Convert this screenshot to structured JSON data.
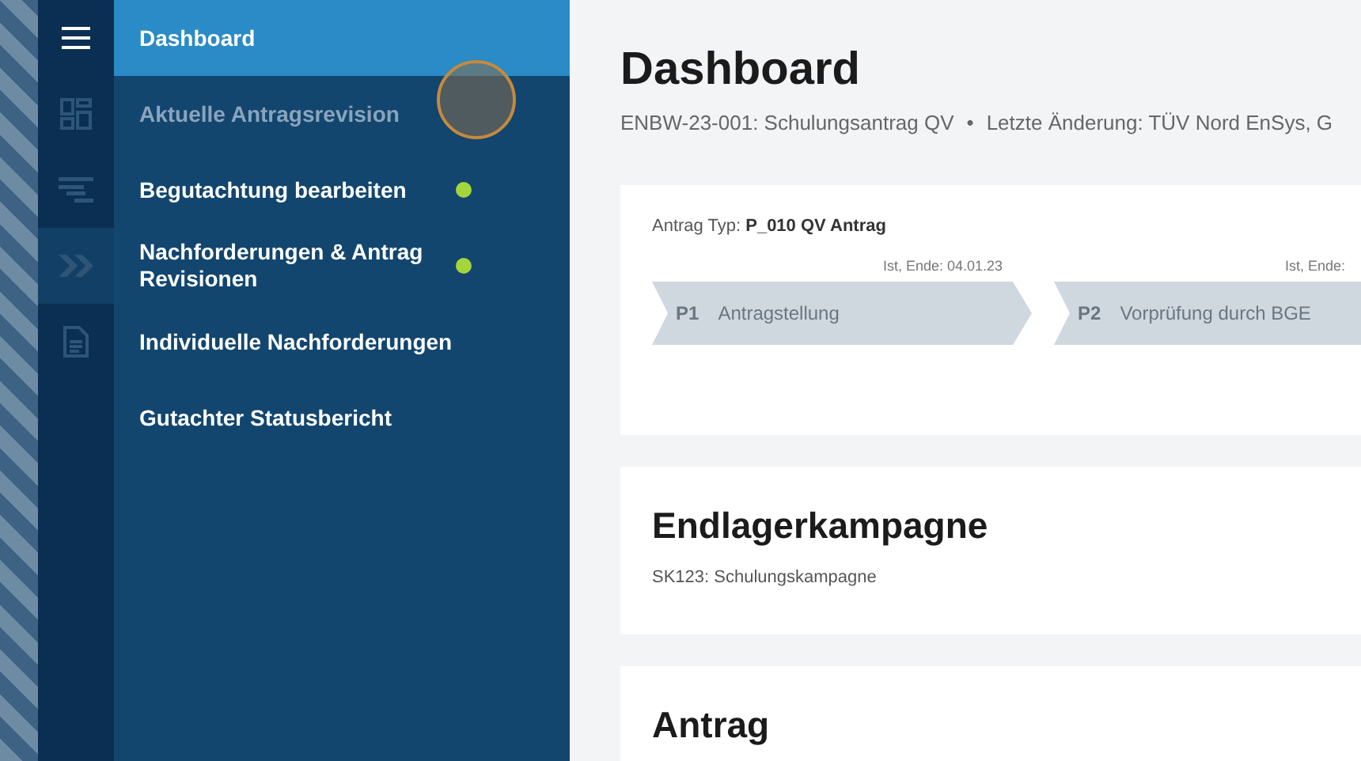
{
  "rail": {
    "items": [
      {
        "kind": "dashboard",
        "selected": false
      },
      {
        "kind": "list",
        "selected": false
      },
      {
        "kind": "chevrons",
        "selected": true
      },
      {
        "kind": "document",
        "selected": false
      }
    ]
  },
  "menu": {
    "items": [
      {
        "label": "Dashboard",
        "selected": true,
        "disabled": false,
        "notification": false
      },
      {
        "label": "Aktuelle Antragsrevision",
        "selected": false,
        "disabled": true,
        "notification": false
      },
      {
        "label": "Begutachtung bearbeiten",
        "selected": false,
        "disabled": false,
        "notification": true
      },
      {
        "label": "Nachforderungen & Antrag Revisionen",
        "selected": false,
        "disabled": false,
        "notification": true
      },
      {
        "label": "Individuelle Nachforderungen",
        "selected": false,
        "disabled": false,
        "notification": false
      },
      {
        "label": "Gutachter Statusbericht",
        "selected": false,
        "disabled": false,
        "notification": false
      }
    ]
  },
  "page": {
    "title": "Dashboard",
    "subtitle": "ENBW-23-001: Schulungsantrag QV",
    "separator": "•",
    "last_change": "Letzte Änderung: TÜV Nord EnSys, G"
  },
  "process_card": {
    "type_label": "Antrag Typ:",
    "type_value": "P_010 QV Antrag",
    "phases": [
      {
        "code": "P1",
        "name": "Antragstellung",
        "end": "Ist, Ende: 04.01.23"
      },
      {
        "code": "P2",
        "name": "Vorprüfung durch BGE",
        "end": "Ist, Ende:"
      }
    ]
  },
  "campaign_card": {
    "title": "Endlagerkampagne",
    "text": "SK123: Schulungskampagne"
  },
  "application_card": {
    "title": "Antrag"
  }
}
